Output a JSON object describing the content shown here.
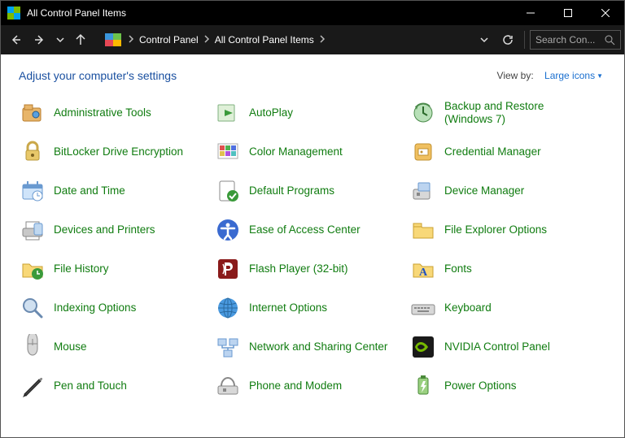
{
  "window": {
    "title": "All Control Panel Items"
  },
  "nav": {
    "crumb1": "Control Panel",
    "crumb2": "All Control Panel Items",
    "search_placeholder": "Search Con..."
  },
  "header": {
    "heading": "Adjust your computer's settings",
    "viewby_label": "View by:",
    "viewby_value": "Large icons"
  },
  "items": [
    {
      "label": "Administrative Tools",
      "icon": "admin-tools"
    },
    {
      "label": "AutoPlay",
      "icon": "autoplay"
    },
    {
      "label": "Backup and Restore (Windows 7)",
      "icon": "backup"
    },
    {
      "label": "BitLocker Drive Encryption",
      "icon": "bitlocker"
    },
    {
      "label": "Color Management",
      "icon": "color"
    },
    {
      "label": "Credential Manager",
      "icon": "credential"
    },
    {
      "label": "Date and Time",
      "icon": "datetime"
    },
    {
      "label": "Default Programs",
      "icon": "default-programs"
    },
    {
      "label": "Device Manager",
      "icon": "device-manager"
    },
    {
      "label": "Devices and Printers",
      "icon": "devices-printers"
    },
    {
      "label": "Ease of Access Center",
      "icon": "ease-of-access"
    },
    {
      "label": "File Explorer Options",
      "icon": "file-explorer-options"
    },
    {
      "label": "File History",
      "icon": "file-history"
    },
    {
      "label": "Flash Player (32-bit)",
      "icon": "flash"
    },
    {
      "label": "Fonts",
      "icon": "fonts"
    },
    {
      "label": "Indexing Options",
      "icon": "indexing"
    },
    {
      "label": "Internet Options",
      "icon": "internet"
    },
    {
      "label": "Keyboard",
      "icon": "keyboard"
    },
    {
      "label": "Mouse",
      "icon": "mouse"
    },
    {
      "label": "Network and Sharing Center",
      "icon": "network"
    },
    {
      "label": "NVIDIA Control Panel",
      "icon": "nvidia"
    },
    {
      "label": "Pen and Touch",
      "icon": "pen"
    },
    {
      "label": "Phone and Modem",
      "icon": "phone"
    },
    {
      "label": "Power Options",
      "icon": "power"
    }
  ]
}
